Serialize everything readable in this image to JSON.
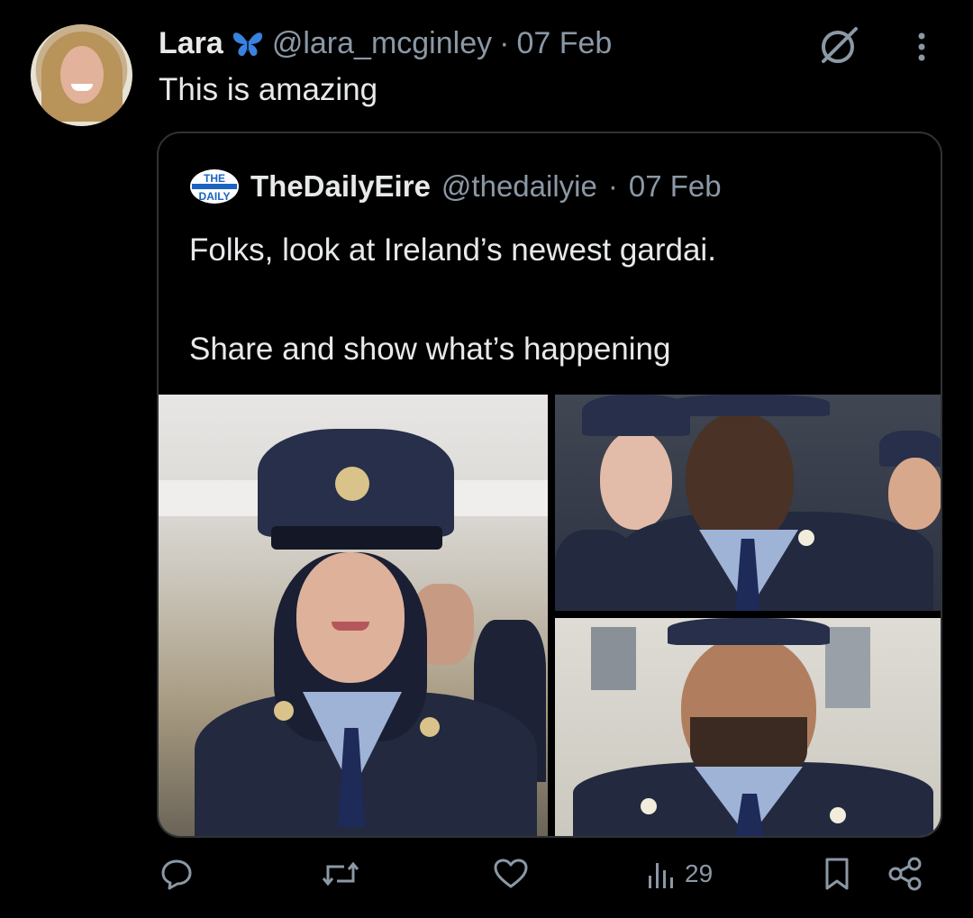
{
  "tweet": {
    "author_name": "Lara",
    "author_handle": "@lara_mcginley",
    "separator": "·",
    "date": "07 Feb",
    "text": "This is amazing"
  },
  "quote": {
    "logo_text_top": "THE",
    "logo_text_bottom": "DAILY",
    "author_name": "TheDailyEire",
    "author_handle": "@thedailyie",
    "separator": "·",
    "date": "07 Feb",
    "text_line1": "Folks, look at Ireland’s newest gardai.",
    "text_line2": "Share and show what’s happening"
  },
  "actions": {
    "views": "29"
  },
  "icons": [
    "grok-icon",
    "more-icon",
    "reply-icon",
    "retweet-icon",
    "like-icon",
    "views-icon",
    "bookmark-icon",
    "share-icon"
  ],
  "colors": {
    "background": "#000000",
    "text": "#e7e9ea",
    "muted": "#8b98a5",
    "border": "#2f3336"
  }
}
